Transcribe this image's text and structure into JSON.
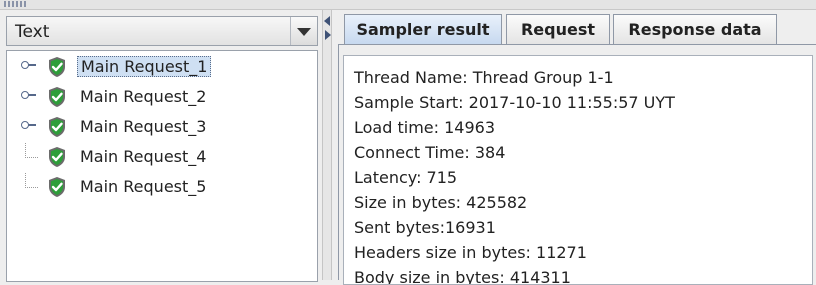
{
  "left_panel": {
    "renderer_label": "Text",
    "tree_items": [
      {
        "label": "Main Request_1",
        "selected": true,
        "expandable": true
      },
      {
        "label": "Main Request_2",
        "selected": false,
        "expandable": true
      },
      {
        "label": "Main Request_3",
        "selected": false,
        "expandable": true
      },
      {
        "label": "Main Request_4",
        "selected": false,
        "expandable": false
      },
      {
        "label": "Main Request_5",
        "selected": false,
        "expandable": false
      }
    ]
  },
  "tabs": [
    {
      "label": "Sampler result",
      "active": true
    },
    {
      "label": "Request",
      "active": false
    },
    {
      "label": "Response data",
      "active": false
    }
  ],
  "sampler_result": {
    "lines": [
      "Thread Name: Thread Group 1-1",
      "Sample Start: 2017-10-10 11:55:57 UYT",
      "Load time: 14963",
      "Connect Time: 384",
      "Latency: 715",
      "Size in bytes: 425582",
      "Sent bytes:16931",
      "Headers size in bytes: 11271",
      "Body size in bytes: 414311"
    ]
  },
  "colors": {
    "success_icon": "#2e9e3a",
    "shield": "#6b6b6b",
    "selection": "#cfe0f3",
    "active_tab": "#c3d6ee"
  }
}
